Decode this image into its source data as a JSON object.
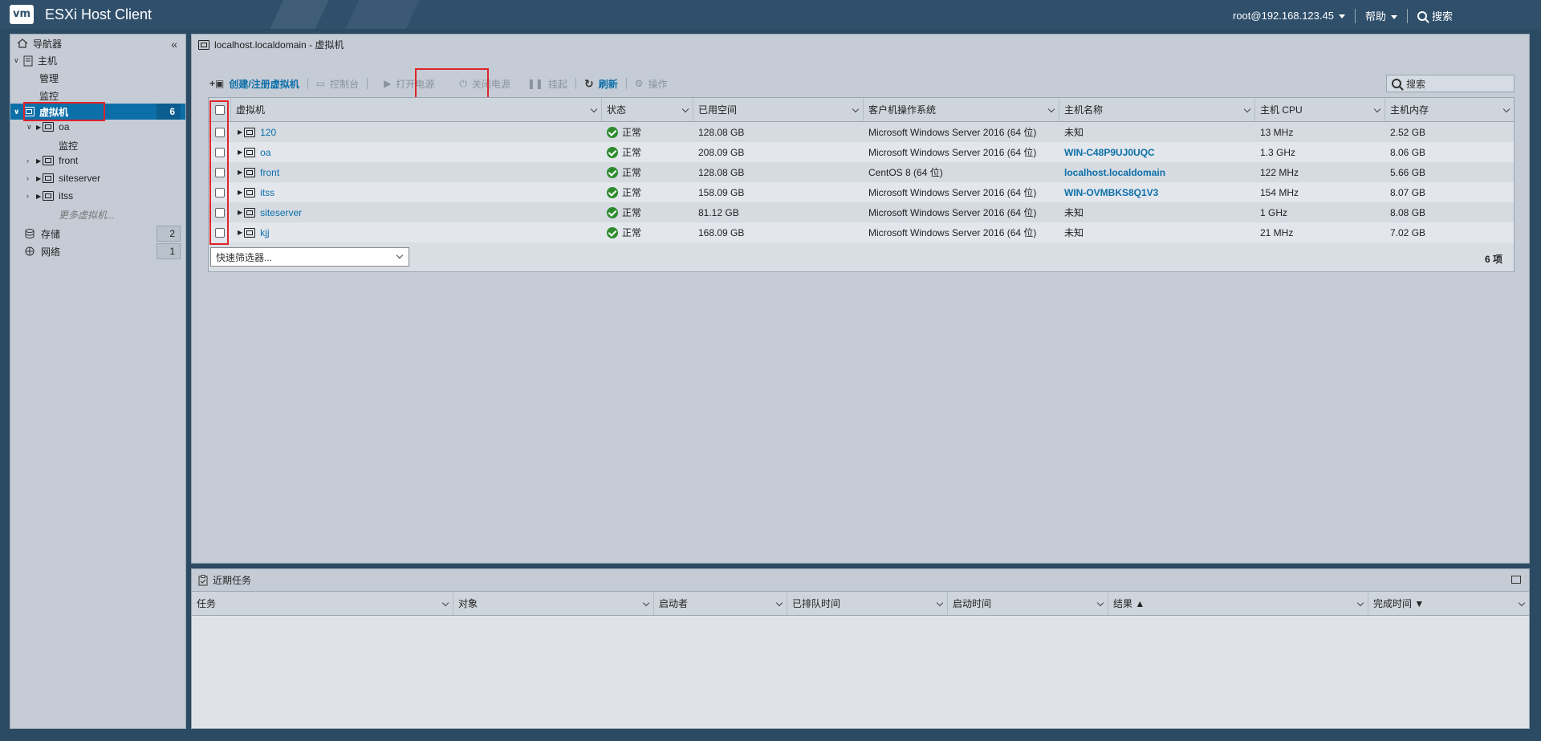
{
  "topbar": {
    "logo": "vm",
    "app_title": "ESXi Host Client",
    "user": "root@192.168.123.45",
    "help": "帮助",
    "search": "搜索"
  },
  "nav": {
    "title": "导航器",
    "host": "主机",
    "manage": "管理",
    "monitor": "监控",
    "vms": "虚拟机",
    "vms_count": "6",
    "tree": [
      "oa",
      "监控",
      "front",
      "siteserver",
      "itss"
    ],
    "more": "更多虚拟机...",
    "storage": "存储",
    "storage_count": "2",
    "network": "网络",
    "network_count": "1"
  },
  "main": {
    "title": "localhost.localdomain - 虚拟机",
    "toolbar": {
      "create": "创建/注册虚拟机",
      "console": "控制台",
      "power_on": "打开电源",
      "power_off": "关闭电源",
      "suspend": "挂起",
      "refresh": "刷新",
      "actions": "操作",
      "search_placeholder": "搜索"
    },
    "columns": [
      "虚拟机",
      "状态",
      "已用空间",
      "客户机操作系统",
      "主机名称",
      "主机 CPU",
      "主机内存"
    ],
    "rows": [
      {
        "name": "120",
        "status": "正常",
        "used": "128.08 GB",
        "os": "Microsoft Windows Server 2016 (64 位)",
        "hostname": "未知",
        "cpu": "13 MHz",
        "mem": "2.52 GB"
      },
      {
        "name": "oa",
        "status": "正常",
        "used": "208.09 GB",
        "os": "Microsoft Windows Server 2016 (64 位)",
        "hostname": "WIN-C48P9UJ0UQC",
        "cpu": "1.3 GHz",
        "mem": "8.06 GB"
      },
      {
        "name": "front",
        "status": "正常",
        "used": "128.08 GB",
        "os": "CentOS 8 (64 位)",
        "hostname": "localhost.localdomain",
        "cpu": "122 MHz",
        "mem": "5.66 GB"
      },
      {
        "name": "itss",
        "status": "正常",
        "used": "158.09 GB",
        "os": "Microsoft Windows Server 2016 (64 位)",
        "hostname": "WIN-OVMBKS8Q1V3",
        "cpu": "154 MHz",
        "mem": "8.07 GB"
      },
      {
        "name": "siteserver",
        "status": "正常",
        "used": "81.12 GB",
        "os": "Microsoft Windows Server 2016 (64 位)",
        "hostname": "未知",
        "cpu": "1 GHz",
        "mem": "8.08 GB"
      },
      {
        "name": "kjj",
        "status": "正常",
        "used": "168.09 GB",
        "os": "Microsoft Windows Server 2016 (64 位)",
        "hostname": "未知",
        "cpu": "21 MHz",
        "mem": "7.02 GB"
      }
    ],
    "filter_placeholder": "快速筛选器...",
    "item_count": "6 项"
  },
  "tasks": {
    "title": "近期任务",
    "columns": [
      "任务",
      "对象",
      "启动者",
      "已排队时间",
      "启动时间",
      "结果 ▲",
      "完成时间 ▼"
    ]
  }
}
